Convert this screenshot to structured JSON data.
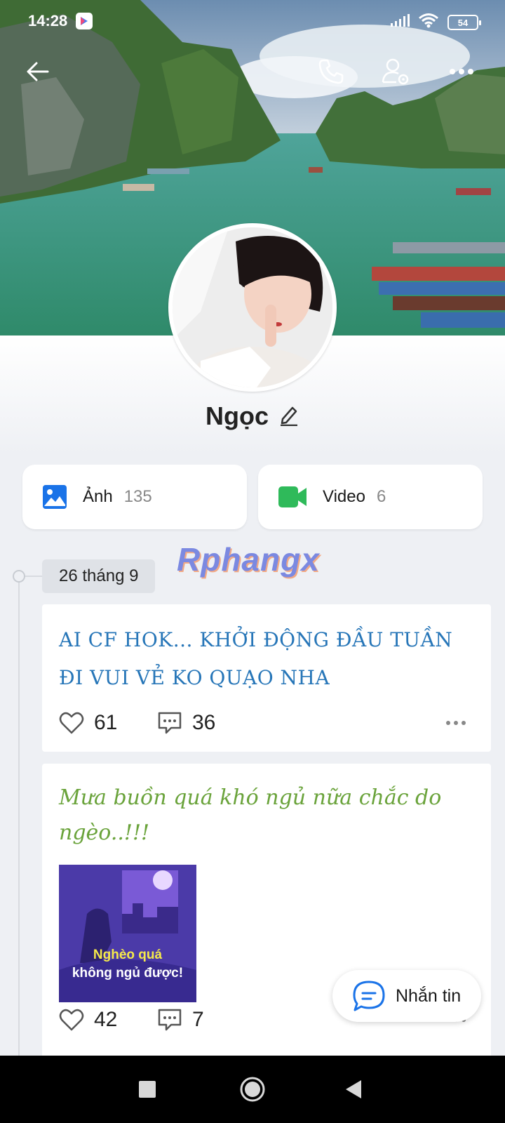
{
  "status_bar": {
    "time": "14:28",
    "battery": "54"
  },
  "profile": {
    "name": "Ngọc"
  },
  "media": {
    "photos": {
      "label": "Ảnh",
      "count": "135"
    },
    "videos": {
      "label": "Video",
      "count": "6"
    }
  },
  "watermark": "Rphangx",
  "timeline": {
    "date_label": "26 tháng 9"
  },
  "posts": [
    {
      "text": "AI CF HOK... KHỞI ĐỘNG ĐẦU TUẦN ĐI VUI VẺ KO QUẠO NHA",
      "likes": "61",
      "comments": "36"
    },
    {
      "text": "Mưa buồn quá khó ngủ nữa chắc do ngèo..!!!",
      "image_caption_line1": "Nghèo quá",
      "image_caption_line2": "không ngủ được!",
      "likes": "42",
      "comments": "7"
    }
  ],
  "chat_button": {
    "label": "Nhắn tin"
  },
  "colors": {
    "accent": "#1a73e8",
    "post1_text": "#2776b8",
    "post2_text": "#6aa33b",
    "video_icon": "#2fba5a"
  },
  "icons": [
    "back-arrow-icon",
    "phone-icon",
    "user-settings-icon",
    "more-icon",
    "edit-icon",
    "photo-icon",
    "video-icon",
    "heart-icon",
    "comment-icon",
    "chat-icon",
    "nav-square-icon",
    "nav-circle-icon",
    "nav-triangle-icon"
  ]
}
